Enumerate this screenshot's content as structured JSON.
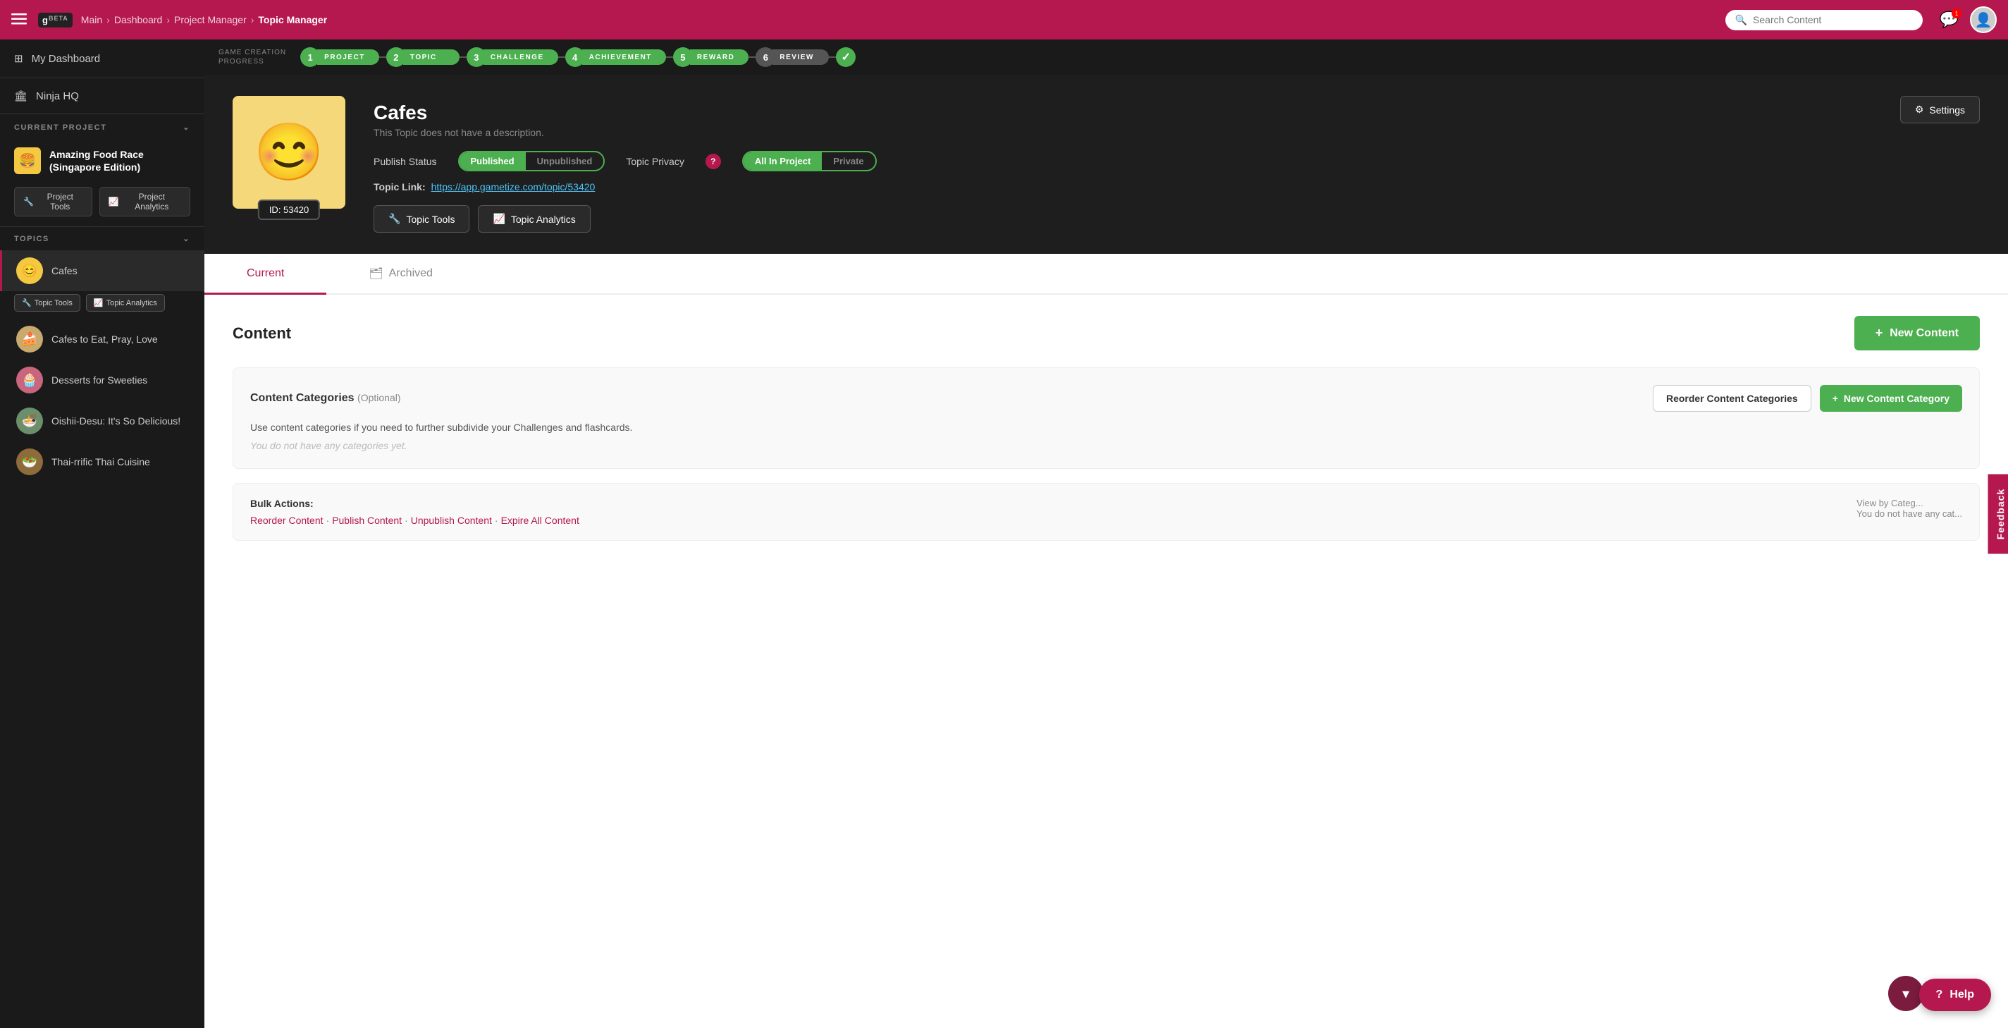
{
  "app": {
    "title": "Topic Manager"
  },
  "topnav": {
    "menu_icon": "☰",
    "logo": "g",
    "logo_beta": "BETA",
    "breadcrumbs": [
      "Main",
      "Dashboard",
      "Project Manager",
      "Topic Manager"
    ],
    "search_placeholder": "Search Content",
    "chat_icon": "💬",
    "chat_badge": "1"
  },
  "sidebar": {
    "my_dashboard": "My Dashboard",
    "ninja_hq": "Ninja HQ",
    "current_project_label": "CURRENT PROJECT",
    "project_icon": "🍔",
    "project_name": "Amazing Food Race (Singapore Edition)",
    "project_tools_btn": "Project Tools",
    "project_analytics_btn": "Project Analytics",
    "topics_label": "TOPICS",
    "active_topic": {
      "name": "Cafes",
      "emoji": "😊"
    },
    "active_topic_tools_btn": "Topic Tools",
    "active_topic_analytics_btn": "Topic Analytics",
    "other_topics": [
      {
        "name": "Cafes to Eat, Pray, Love",
        "emoji": "🍰"
      },
      {
        "name": "Desserts for Sweeties",
        "emoji": "🧁"
      },
      {
        "name": "Oishii-Desu: It's So Delicious!",
        "emoji": "🍜"
      },
      {
        "name": "Thai-rrific Thai Cuisine",
        "emoji": "🥗"
      }
    ]
  },
  "progress_bar": {
    "label": "GAME CREATION\nPROGRESS",
    "steps": [
      {
        "num": "1",
        "label": "PROJECT",
        "done": true
      },
      {
        "num": "2",
        "label": "TOPIC",
        "done": true
      },
      {
        "num": "3",
        "label": "CHALLENGE",
        "done": true
      },
      {
        "num": "4",
        "label": "ACHIEVEMENT",
        "done": true
      },
      {
        "num": "5",
        "label": "REWARD",
        "done": true
      },
      {
        "num": "6",
        "label": "REVIEW",
        "done": false
      }
    ],
    "check": "✓"
  },
  "topic_header": {
    "emoji": "😊",
    "id_label": "ID: 53420",
    "title": "Cafes",
    "description": "This Topic does not have a description.",
    "publish_status_label": "Publish Status",
    "published_btn": "Published",
    "unpublished_btn": "Unpublished",
    "privacy_label": "Topic Privacy",
    "all_in_project_btn": "All In Project",
    "private_btn": "Private",
    "topic_link_label": "Topic Link:",
    "topic_link_url": "https://app.gametize.com/topic/53420",
    "topic_tools_btn": "Topic Tools",
    "topic_analytics_btn": "Topic Analytics",
    "settings_btn": "Settings"
  },
  "content_tabs": {
    "current": "Current",
    "archived": "Archived"
  },
  "content_section": {
    "title": "Content",
    "new_content_btn": "New Content",
    "categories_title": "Content Categories",
    "categories_optional": "(Optional)",
    "categories_desc": "Use content categories if you need to further subdivide your Challenges and flashcards.",
    "categories_empty": "You do not have any categories yet.",
    "reorder_btn": "Reorder Content Categories",
    "new_category_btn": "New Content Category",
    "bulk_label": "Bulk Actions:",
    "bulk_links": [
      "Reorder Content",
      "Publish Content",
      "Unpublish Content",
      "Expire All Content"
    ],
    "view_by_label": "View by Categ...",
    "view_by_note": "You do not have any cat..."
  },
  "feedback": {
    "label": "Feedback"
  },
  "help": {
    "label": "Help"
  }
}
